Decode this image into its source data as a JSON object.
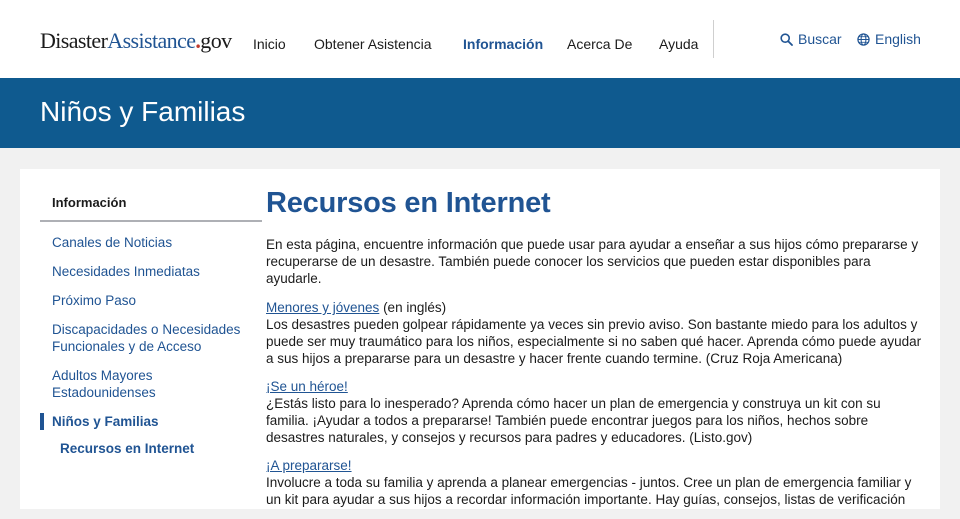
{
  "header": {
    "logo": {
      "part1": "Disaster",
      "part2": "Assistance",
      "dot": ".",
      "part3": "gov"
    },
    "nav": [
      "Inicio",
      "Obtener Asistencia",
      "Información",
      "Acerca De",
      "Ayuda"
    ],
    "search_label": "Buscar",
    "language_label": "English"
  },
  "banner": {
    "title": "Niños y Familias"
  },
  "sidebar": {
    "heading": "Información",
    "items": [
      "Canales de Noticias",
      "Necesidades Inmediatas",
      "Próximo Paso",
      "Discapacidades o Necesidades Funcionales y de Acceso",
      "Adultos Mayores Estadounidenses"
    ],
    "current": "Niños y Familias",
    "sub": "Recursos en Internet"
  },
  "main": {
    "title": "Recursos en Internet",
    "intro": "En esta página, encuentre información que puede usar para ayudar a enseñar a sus hijos cómo prepararse y recuperarse de un desastre. También puede conocer los servicios que pueden estar disponibles para ayudarle.",
    "resources": [
      {
        "link": "Menores y jóvenes",
        "suffix": " (en inglés)",
        "text": "Los desastres pueden golpear rápidamente ya veces sin previo aviso. Son bastante miedo para los adultos y puede ser muy traumático para los niños, especialmente si no saben qué hacer. Aprenda cómo puede ayudar a sus hijos a prepararse para un desastre y hacer frente cuando termine. (Cruz Roja Americana)"
      },
      {
        "link": "¡Se un héroe!",
        "suffix": "",
        "text": "¿Estás listo para lo inesperado? Aprenda cómo hacer un plan de emergencia y construya un kit con su familia. ¡Ayudar a todos a prepararse! También puede encontrar juegos para los niños, hechos sobre desastres naturales, y consejos y recursos para padres y educadores. (Listo.gov)"
      },
      {
        "link": "¡A prepararse!",
        "suffix": "",
        "text": "Involucre a toda su familia y aprenda a planear emergencias - juntos. Cree un plan de emergencia familiar y un kit para ayudar a sus hijos a recordar información importante. Hay guías, consejos, listas de verificación"
      }
    ]
  },
  "colors": {
    "brand_blue": "#205493",
    "banner_blue": "#0f5a8f",
    "logo_dot_red": "#c0392b"
  }
}
